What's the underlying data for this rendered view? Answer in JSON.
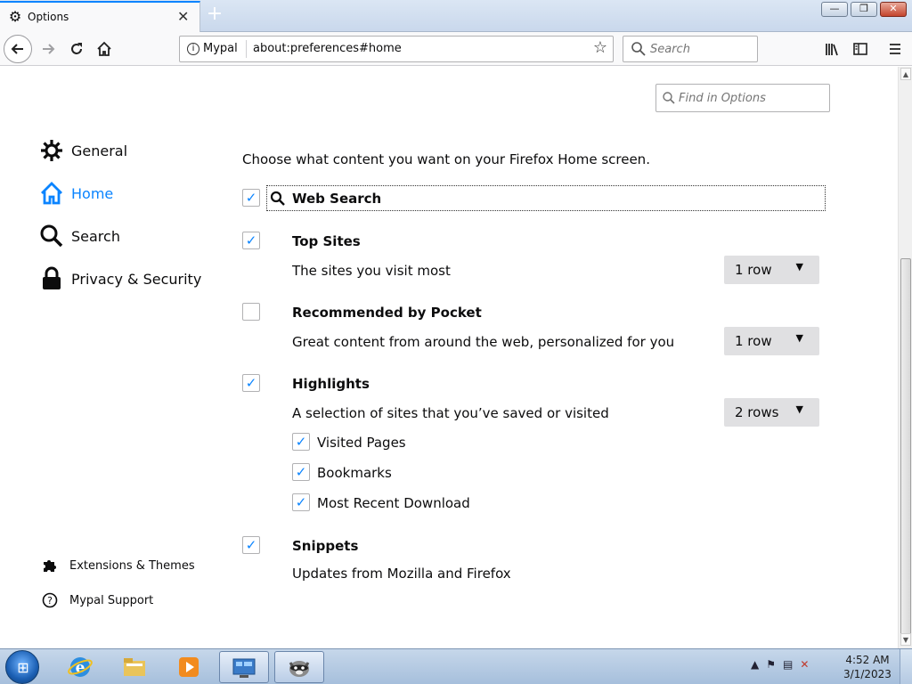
{
  "window": {
    "tab_title": "Options",
    "tab_icon": "gear-icon",
    "new_tab": "+",
    "controls": {
      "minimize": "—",
      "maximize": "❐",
      "close": "✕"
    }
  },
  "toolbar": {
    "identity_label": "Mypal",
    "url": "about:preferences#home",
    "search_placeholder": "Search"
  },
  "find": {
    "placeholder": "Find in Options"
  },
  "sidebar": {
    "items": [
      {
        "label": "General",
        "icon": "gear-icon"
      },
      {
        "label": "Home",
        "icon": "home-icon",
        "active": true
      },
      {
        "label": "Search",
        "icon": "search-icon"
      },
      {
        "label": "Privacy & Security",
        "icon": "lock-icon"
      }
    ],
    "footer": [
      {
        "label": "Extensions & Themes",
        "icon": "puzzle-icon"
      },
      {
        "label": "Mypal Support",
        "icon": "help-icon"
      }
    ]
  },
  "main": {
    "intro": "Choose what content you want on your Firefox Home screen.",
    "options": {
      "web_search": {
        "title": "Web Search",
        "checked": true
      },
      "top_sites": {
        "title": "Top Sites",
        "desc": "The sites you visit most",
        "rows": "1 row",
        "checked": true
      },
      "pocket": {
        "title": "Recommended by Pocket",
        "desc": "Great content from around the web, personalized for you",
        "rows": "1 row",
        "checked": false
      },
      "highlights": {
        "title": "Highlights",
        "desc": "A selection of sites that you’ve saved or visited",
        "rows": "2 rows",
        "checked": true,
        "sub": [
          "Visited Pages",
          "Bookmarks",
          "Most Recent Download"
        ]
      },
      "snippets": {
        "title": "Snippets",
        "desc": "Updates from Mozilla and Firefox",
        "checked": true
      }
    }
  },
  "taskbar": {
    "time": "4:52 AM",
    "date": "3/1/2023"
  },
  "colors": {
    "accent": "#0a84ff",
    "dropdown_bg": "#e0e0e2"
  }
}
